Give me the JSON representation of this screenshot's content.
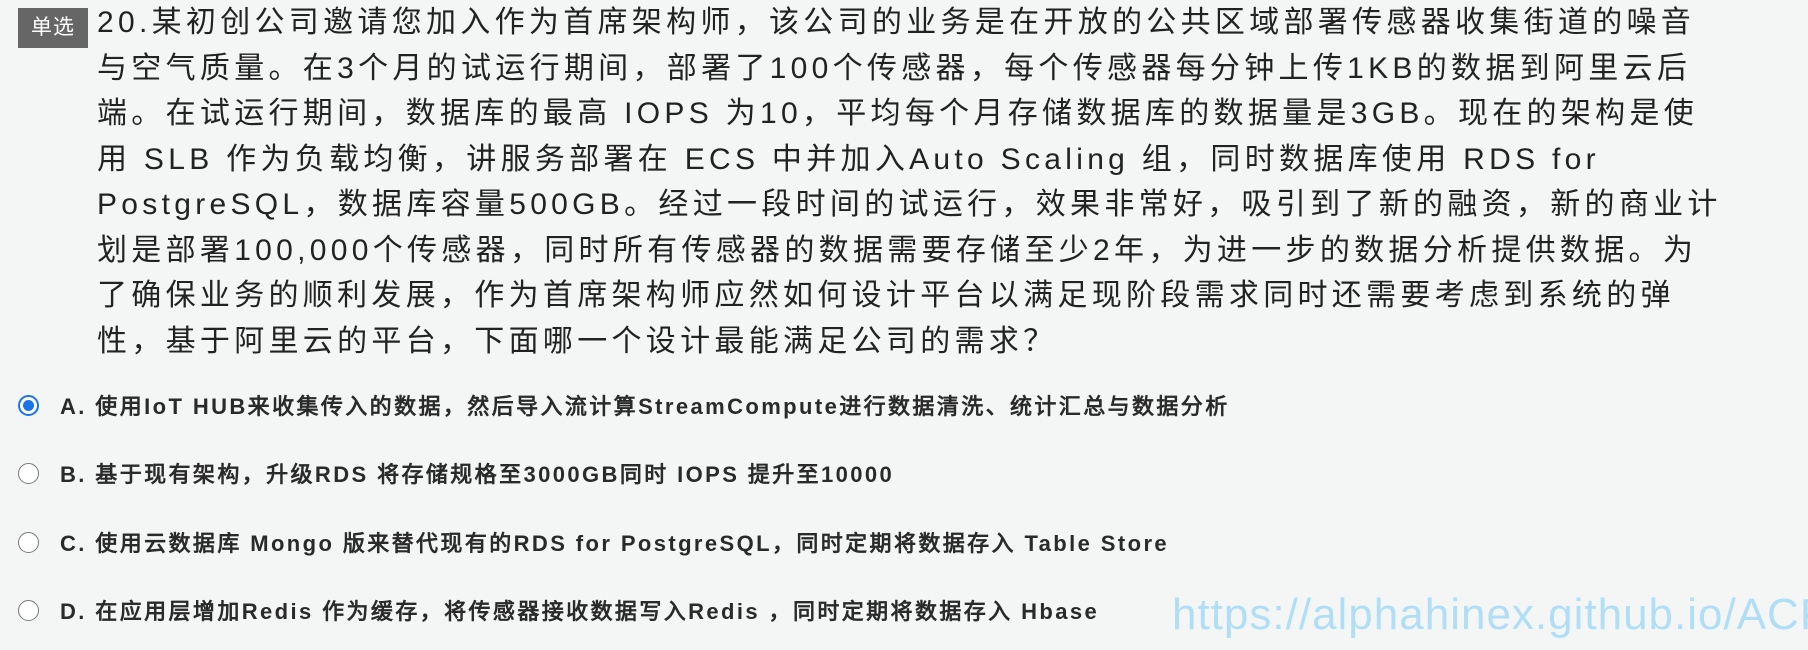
{
  "question": {
    "type_badge": "单选",
    "lines": [
      "20.某初创公司邀请您加入作为首席架构师，该公司的业务是在开放的公共区域部署传感器收集街道的噪音",
      "与空气质量。在3个月的试运行期间，部署了100个传感器，每个传感器每分钟上传1KB的数据到阿里云后",
      "端。在试运行期间，数据库的最高 IOPS 为10，平均每个月存储数据库的数据量是3GB。现在的架构是使",
      "用 SLB 作为负载均衡，讲服务部署在 ECS 中并加入Auto Scaling 组，同时数据库使用 RDS for",
      "PostgreSQL，数据库容量500GB。经过一段时间的试运行，效果非常好，吸引到了新的融资，新的商业计",
      "划是部署100,000个传感器，同时所有传感器的数据需要存储至少2年，为进一步的数据分析提供数据。为",
      "了确保业务的顺利发展，作为首席架构师应然如何设计平台以满足现阶段需求同时还需要考虑到系统的弹",
      "性，基于阿里云的平台，下面哪一个设计最能满足公司的需求？"
    ]
  },
  "options": [
    {
      "label": "A. 使用IoT HUB来收集传入的数据，然后导入流计算StreamCompute进行数据清洗、统计汇总与数据分析",
      "selected": true
    },
    {
      "label": "B. 基于现有架构，升级RDS 将存储规格至3000GB同时 IOPS 提升至10000",
      "selected": false
    },
    {
      "label": "C. 使用云数据库 Mongo 版来替代现有的RDS for PostgreSQL，同时定期将数据存入 Table Store",
      "selected": false
    },
    {
      "label": "D. 在应用层增加Redis 作为缓存，将传感器接收数据写入Redis ，同时定期将数据存入 Hbase",
      "selected": false
    }
  ],
  "watermark": "https://alphahinex.github.io/ACP",
  "colors": {
    "accent": "#1a73e8",
    "badge": "#666666",
    "watermark": "#a9dcf7"
  }
}
